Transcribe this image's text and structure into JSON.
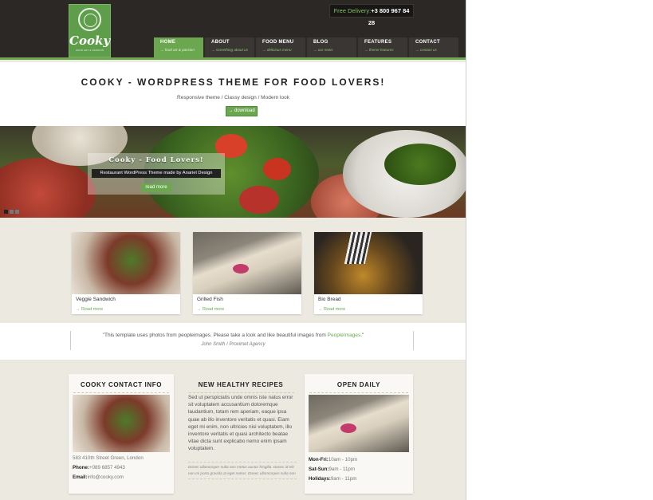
{
  "header": {
    "logo": {
      "name": "Cooky",
      "tagline": "FOOD ART & PASSION"
    },
    "delivery": {
      "label": "Free Delivery:",
      "phone": "+3 800 967 84 28"
    },
    "nav": [
      {
        "label": "HOME",
        "sub": "→ food art & passion"
      },
      {
        "label": "ABOUT",
        "sub": "→ something about us"
      },
      {
        "label": "FOOD MENU",
        "sub": "→ delicious menu"
      },
      {
        "label": "BLOG",
        "sub": "→ our news"
      },
      {
        "label": "FEATURES",
        "sub": "→ theme features"
      },
      {
        "label": "CONTACT",
        "sub": "→ contact us"
      }
    ]
  },
  "intro": {
    "title": "COOKY - WORDPRESS THEME FOR FOOD LOVERS!",
    "subtitle": "Responsive theme / Classy design / Modern look",
    "button": "→ download"
  },
  "slider": {
    "title": "Cooky - Food Lovers!",
    "subtitle": "Restaurant WordPress Theme made by Anariel Design",
    "button": "read more"
  },
  "cards": [
    {
      "title": "Veggie Sandwich",
      "link": "→ Read more"
    },
    {
      "title": "Grilled Fish",
      "link": "→ Read more"
    },
    {
      "title": "Bio Bread",
      "link": "→ Read more"
    }
  ],
  "quote": {
    "text": "\"This template uses photos from peopleimages. Please take a look and like beautiful images from ",
    "link": "PeopleImages.",
    "end": "\"",
    "author": "John Smith / Proximet Agency"
  },
  "contact": {
    "title": "COOKY CONTACT INFO",
    "address": "583 410th Street Green, London",
    "phone_label": "Phone:",
    "phone": "+089 6857 4943",
    "email_label": "Email:",
    "email": "info@cooky.com"
  },
  "recipes": {
    "title": "NEW HEALTHY RECIPES",
    "text": "Sed ut perspiciatis unde omnis iste natus error sit voluptatem accusantium doloremque laudantium, totam rem aperiam, eaque ipsa quae ab illo inventore veritatis et quasi. Eiam eget mi enim, non ultricies nisi voluptatem, illo inventore veritatis et quasi architecto beatae vitae dicta sunt explicabo nemo enim ipsam voluptatem.",
    "note": "Donec ullamcorper nulla non metus auctor fringilla. Donec id elit non mi porta gravida at eget metus. Donec ullamcorper nulla non"
  },
  "hours": {
    "title": "OPEN DAILY",
    "rows": [
      {
        "day": "Mon-Fri:",
        "time": "10am - 10pm"
      },
      {
        "day": "Sat-Sun:",
        "time": "9am - 11pm"
      },
      {
        "day": "Holidays:",
        "time": "9am - 11pm"
      }
    ]
  },
  "colors": {
    "accent": "#6aa74f",
    "header": "#2b2826",
    "body": "#ece9e1"
  }
}
